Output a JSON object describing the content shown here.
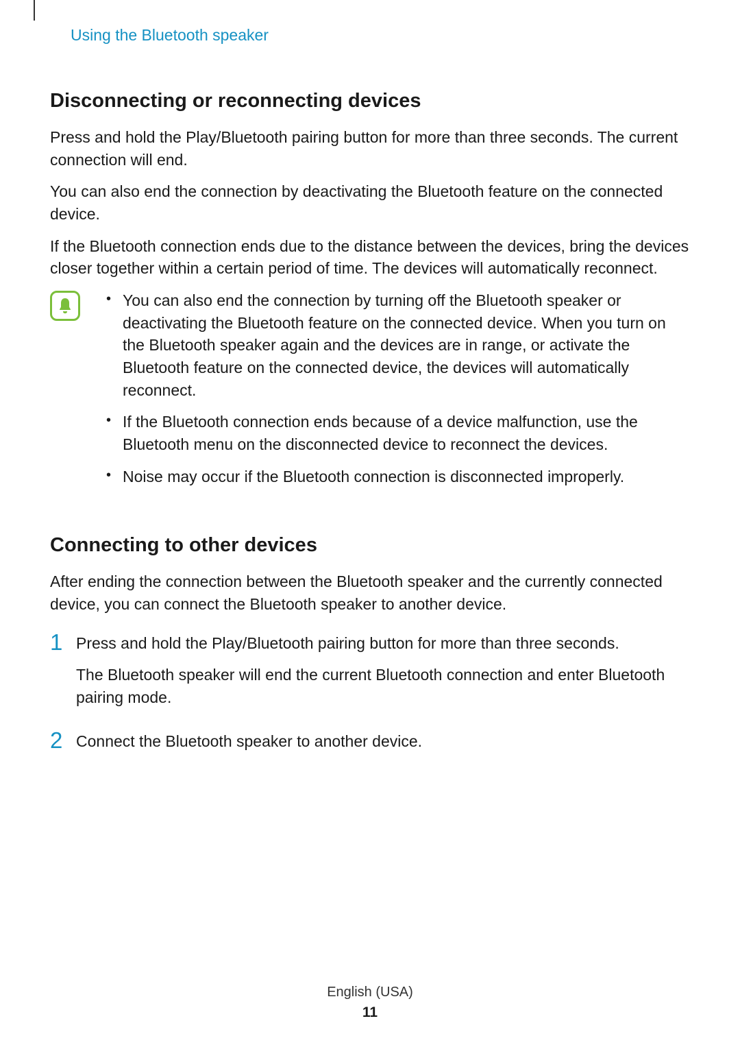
{
  "header": {
    "section_label": "Using the Bluetooth speaker"
  },
  "section1": {
    "heading": "Disconnecting or reconnecting devices",
    "para1": "Press and hold the Play/Bluetooth pairing button for more than three seconds. The current connection will end.",
    "para2": "You can also end the connection by deactivating the Bluetooth feature on the connected device.",
    "para3": "If the Bluetooth connection ends due to the distance between the devices, bring the devices closer together within a certain period of time. The devices will automatically reconnect.",
    "notes": {
      "item1": "You can also end the connection by turning off the Bluetooth speaker or deactivating the Bluetooth feature on the connected device. When you turn on the Bluetooth speaker again and the devices are in range, or activate the Bluetooth feature on the connected device, the devices will automatically reconnect.",
      "item2": "If the Bluetooth connection ends because of a device malfunction, use the Bluetooth menu on the disconnected device to reconnect the devices.",
      "item3": "Noise may occur if the Bluetooth connection is disconnected improperly."
    }
  },
  "section2": {
    "heading": "Connecting to other devices",
    "para1": "After ending the connection between the Bluetooth speaker and the currently connected device, you can connect the Bluetooth speaker to another device.",
    "steps": {
      "n1": "1",
      "n2": "2",
      "step1_a": "Press and hold the Play/Bluetooth pairing button for more than three seconds.",
      "step1_b": "The Bluetooth speaker will end the current Bluetooth connection and enter Bluetooth pairing mode.",
      "step2": "Connect the Bluetooth speaker to another device."
    }
  },
  "footer": {
    "language": "English (USA)",
    "page_number": "11"
  }
}
